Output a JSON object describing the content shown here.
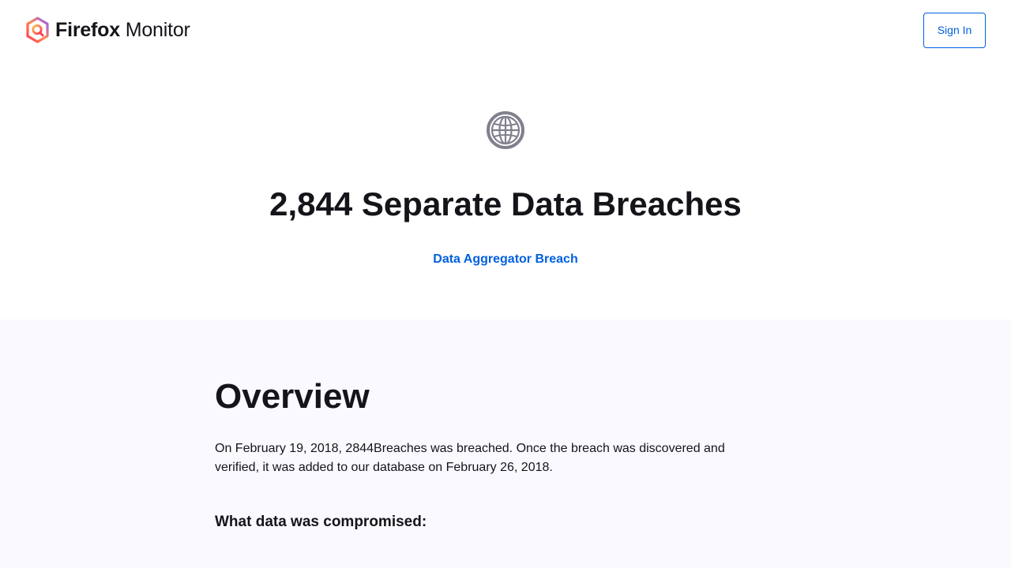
{
  "header": {
    "brand_bold": "Firefox",
    "brand_light": "Monitor",
    "sign_in_label": "Sign In"
  },
  "hero": {
    "icon": "globe-icon",
    "title": "2,844 Separate Data Breaches",
    "category_link": "Data Aggregator Breach"
  },
  "overview": {
    "title": "Overview",
    "text": "On February 19, 2018, 2844Breaches was breached. Once the breach was discovered and verified, it was added to our database on February 26, 2018.",
    "compromised_heading": "What data was compromised:"
  },
  "colors": {
    "accent": "#0060df",
    "overview_bg": "#f9f9fe",
    "icon_gray": "#80808e",
    "text": "#15141a"
  }
}
